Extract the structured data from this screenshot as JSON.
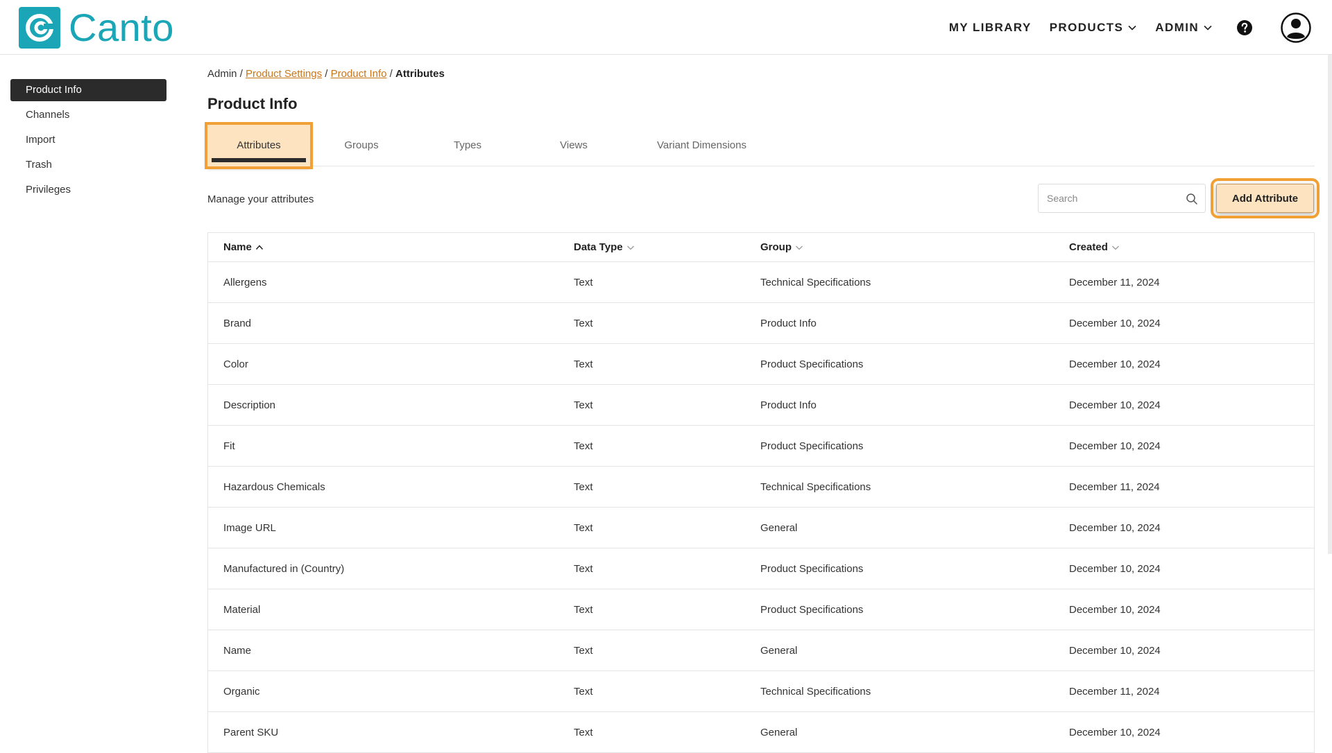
{
  "header": {
    "brand": "Canto",
    "nav": [
      {
        "label": "MY LIBRARY",
        "has_dropdown": false
      },
      {
        "label": "PRODUCTS",
        "has_dropdown": true
      },
      {
        "label": "ADMIN",
        "has_dropdown": true
      }
    ],
    "icons": [
      "help-icon",
      "user-avatar-icon"
    ]
  },
  "sidebar": {
    "items": [
      {
        "label": "Product Info",
        "active": true
      },
      {
        "label": "Channels",
        "active": false
      },
      {
        "label": "Import",
        "active": false
      },
      {
        "label": "Trash",
        "active": false
      },
      {
        "label": "Privileges",
        "active": false
      }
    ]
  },
  "breadcrumb": {
    "root": "Admin",
    "sep": " / ",
    "link1": "Product Settings",
    "link2": "Product Info",
    "current": "Attributes"
  },
  "page_title": "Product Info",
  "tabs": [
    {
      "label": "Attributes",
      "active": true
    },
    {
      "label": "Groups",
      "active": false
    },
    {
      "label": "Types",
      "active": false
    },
    {
      "label": "Views",
      "active": false
    },
    {
      "label": "Variant Dimensions",
      "active": false
    }
  ],
  "toolbar": {
    "description": "Manage your attributes",
    "search_placeholder": "Search",
    "add_label": "Add Attribute"
  },
  "table": {
    "columns": [
      {
        "label": "Name",
        "sort": "asc"
      },
      {
        "label": "Data Type",
        "sort": "none"
      },
      {
        "label": "Group",
        "sort": "none"
      },
      {
        "label": "Created",
        "sort": "none"
      }
    ],
    "rows": [
      [
        "Allergens",
        "Text",
        "Technical Specifications",
        "December 11, 2024"
      ],
      [
        "Brand",
        "Text",
        "Product Info",
        "December 10, 2024"
      ],
      [
        "Color",
        "Text",
        "Product Specifications",
        "December 10, 2024"
      ],
      [
        "Description",
        "Text",
        "Product Info",
        "December 10, 2024"
      ],
      [
        "Fit",
        "Text",
        "Product Specifications",
        "December 10, 2024"
      ],
      [
        "Hazardous Chemicals",
        "Text",
        "Technical Specifications",
        "December 11, 2024"
      ],
      [
        "Image URL",
        "Text",
        "General",
        "December 10, 2024"
      ],
      [
        "Manufactured in (Country)",
        "Text",
        "Product Specifications",
        "December 10, 2024"
      ],
      [
        "Material",
        "Text",
        "Product Specifications",
        "December 10, 2024"
      ],
      [
        "Name",
        "Text",
        "General",
        "December 10, 2024"
      ],
      [
        "Organic",
        "Text",
        "Technical Specifications",
        "December 11, 2024"
      ],
      [
        "Parent SKU",
        "Text",
        "General",
        "December 10, 2024"
      ]
    ]
  },
  "colors": {
    "brand": "#1aa6b7",
    "link": "#c8761a",
    "highlight": "#f0a035",
    "highlight_fill": "#fde3c0",
    "sidebar_active": "#2b2b2b"
  }
}
